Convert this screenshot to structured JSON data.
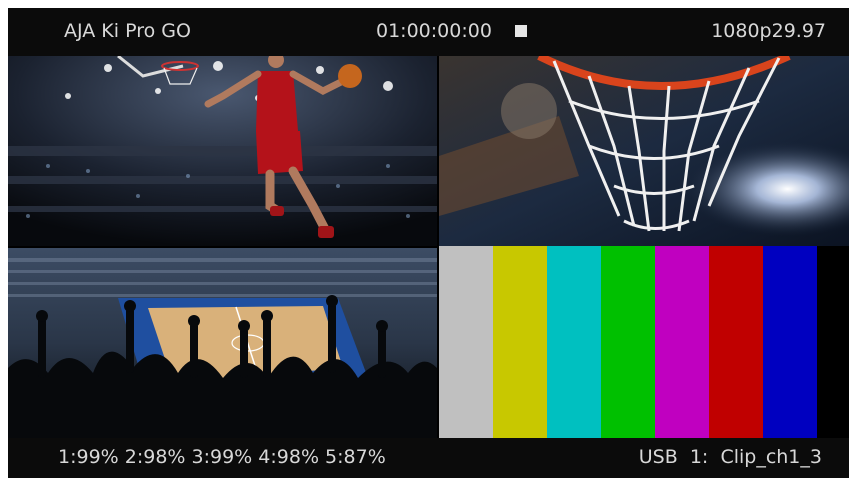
{
  "topbar": {
    "device_name": "AJA Ki Pro GO",
    "timecode": "01:00:00:00",
    "transport_icon": "stop-icon",
    "video_format": "1080p29.97"
  },
  "bottombar": {
    "media_status": "1:99% 2:98% 3:99% 4:98% 5:87%",
    "media_label": "USB",
    "channel": "1:",
    "clip_name": "Clip_ch1_3"
  },
  "quadrants": [
    {
      "name": "basketball-player-dunk-feed"
    },
    {
      "name": "basketball-hoop-net-feed"
    },
    {
      "name": "arena-crowd-feed"
    },
    {
      "name": "color-bars-feed"
    }
  ],
  "color_bars": [
    "#c0c0c0",
    "#c8c800",
    "#00c0c0",
    "#00c000",
    "#c000c0",
    "#c00000",
    "#0000c0"
  ],
  "colors": {
    "bar_background": "#0b0b0b",
    "text": "#d8d8d8"
  }
}
